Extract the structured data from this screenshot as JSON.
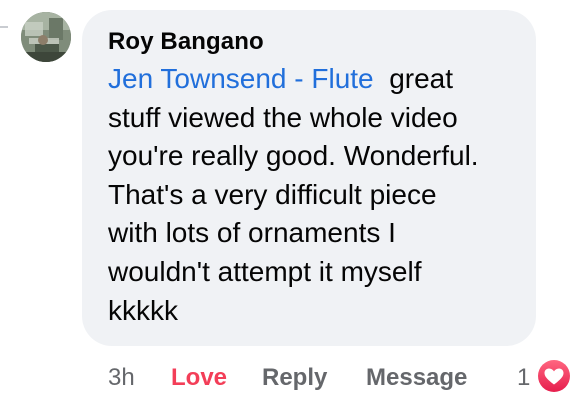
{
  "comment": {
    "author": "Roy Bangano",
    "mention": "Jen Townsend - Flute",
    "text_lines": [
      "great",
      "stuff viewed the whole video",
      "you're really good. Wonderful.",
      "That's a very difficult piece",
      "with lots of ornaments I",
      "wouldn't attempt it myself",
      "kkkkk"
    ],
    "avatar_icon": "profile-photo"
  },
  "actions": {
    "timestamp": "3h",
    "love": "Love",
    "reply": "Reply",
    "message": "Message"
  },
  "reactions": {
    "count": "1",
    "icon": "heart-icon"
  },
  "colors": {
    "bubble": "#f0f2f5",
    "mention": "#216fdb",
    "love": "#f33e58",
    "meta": "#65676b"
  }
}
